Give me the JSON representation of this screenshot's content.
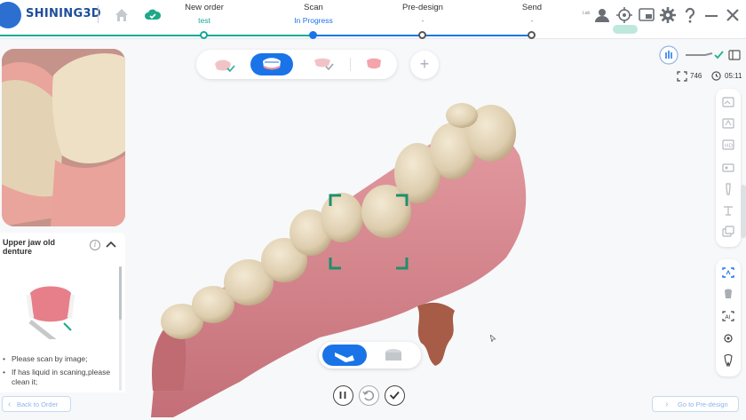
{
  "app": {
    "logo_text": "SHINING3D"
  },
  "steps": [
    {
      "label": "New order",
      "sub": "test",
      "sub_color": "#13a99a"
    },
    {
      "label": "Scan",
      "sub": "In Progress",
      "sub_color": "#1a74e8"
    },
    {
      "label": "Pre-design",
      "sub": "-",
      "sub_color": "#777777"
    },
    {
      "label": "Send",
      "sub": "-",
      "sub_color": "#777777"
    }
  ],
  "header": {
    "mini_label": "Lab"
  },
  "stats": {
    "frames": "746",
    "time": "05:11"
  },
  "panel": {
    "title": "Upper jaw old denture",
    "tips": [
      "Please scan by image;",
      "If has liquid in scaning,please clean it;"
    ]
  },
  "footer": {
    "back_label": "Back to Order",
    "next_label": "Go to Pre-design"
  },
  "colors": {
    "accent": "#1a74e8",
    "progress": "#13a99a",
    "scan_frame": "#1f8f6b",
    "gum": "#d98a8f",
    "tooth": "#e5d7bd"
  }
}
